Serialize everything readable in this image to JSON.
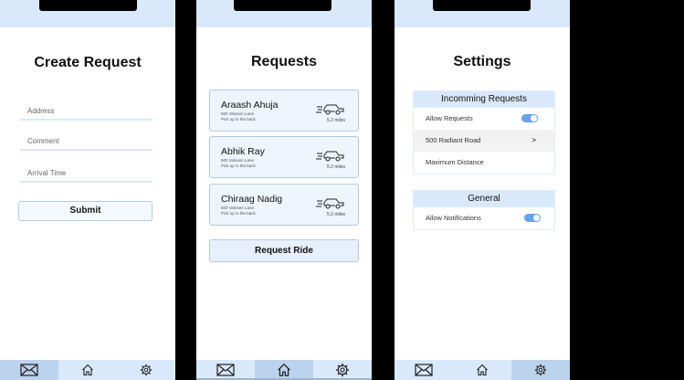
{
  "create": {
    "title": "Create Request",
    "address_placeholder": "Address",
    "comment_placeholder": "Comment",
    "arrival_placeholder": "Arrival Time",
    "submit_label": "Submit"
  },
  "requests": {
    "title": "Requests",
    "cards": [
      {
        "name": "Araash Ahuja",
        "address": "500 Valosen Lane",
        "note": "Pick up in the back",
        "distance": "5.2 miles"
      },
      {
        "name": "Abhik Ray",
        "address": "500 Valosen Lane",
        "note": "Pick up in the back",
        "distance": "5.2 miles"
      },
      {
        "name": "Chiraag Nadig",
        "address": "500 Valosen Lane",
        "note": "Pick up in the back",
        "distance": "5.2 miles"
      }
    ],
    "ride_label": "Request Ride"
  },
  "settings": {
    "title": "Settings",
    "incoming": {
      "header": "Incomming Requests",
      "allow_requests": "Allow Requests",
      "address": "500 Radiant Road",
      "chevron": ">",
      "max_distance": "Maximum Distance"
    },
    "general": {
      "header": "General",
      "allow_notifications": "Allow Notifications"
    }
  },
  "icons": {
    "mail": "mail-icon",
    "home": "home-icon",
    "settings": "gear-icon",
    "car": "car-icon"
  },
  "colors": {
    "accent": "#d9e9fb",
    "toggle_on": "#6aa2e6"
  }
}
